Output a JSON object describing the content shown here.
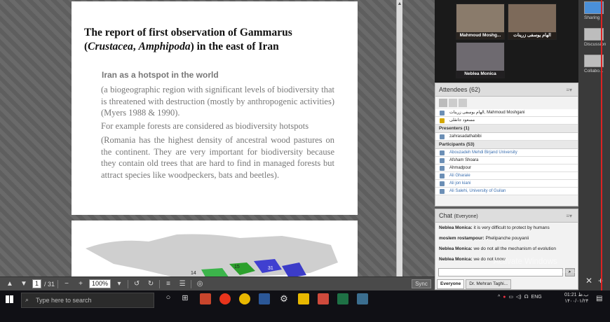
{
  "slide": {
    "title_line1": "The report of first observation of Gammarus",
    "title_line2_prefix": "(",
    "title_crustacea": "Crustacea",
    "title_comma": ", ",
    "title_amphipoda": "Amphipoda",
    "title_suffix": ") in the east of Iran",
    "subtitle": "Iran as a hotspot in the world",
    "para1": "(a biogeographic region with significant levels of biodiversity that is threatened with destruction (mostly by anthropogenic activities) (Myers 1988 & 1990).",
    "para2": "For example forests are considered as biodiversity hotspots",
    "para3": "(Romania has the highest density of ancestral wood pastures on the continent. They are very important for biodiversity because they contain old trees that are hard to find in managed forests but attract species like woodpeckers, bats and beetles).",
    "map_labels": [
      "14",
      "15",
      "31"
    ]
  },
  "doc_toolbar": {
    "page_current": "1",
    "page_total": "/ 31",
    "zoom": "100%",
    "sync_label": "Sync"
  },
  "videos": [
    {
      "name": "Mahmoud Moshg..."
    },
    {
      "name": "الهام یوسفی زرینات"
    },
    {
      "name": "Neblea Monica"
    }
  ],
  "attendees": {
    "header": "Attendees",
    "count": "(62)",
    "hosts_row": "الهام یوسفی زرینات, Mahmoud Moshgani",
    "host_extra": "مسعود جانقلی",
    "presenters_label": "Presenters (1)",
    "presenters": [
      "zahrasadathabibi"
    ],
    "participants_label": "Participants (53)",
    "participants": [
      "Abouzadeh Mehdi Birjand University",
      "Afsham Shoara",
      "Ahmadpour",
      "Ali Gharaie",
      "Ali jon kiani",
      "Ali Salehi, University of Guilan"
    ]
  },
  "chat": {
    "header": "Chat",
    "scope": "(Everyone)",
    "messages": [
      {
        "sender": "Neblea Monica:",
        "text": "it is very difficult to protect by humans"
      },
      {
        "sender": "moslem rostampour:",
        "text": "Phelipanche pouyanii"
      },
      {
        "sender": "Neblea Monica:",
        "text": "we do not all the mechanism of evolution"
      },
      {
        "sender": "Neblea Monica:",
        "text": "we do not know"
      }
    ],
    "tabs": [
      "Everyone",
      "Dr. Mehran Taghi..."
    ]
  },
  "rail": {
    "sharing": "Sharing",
    "discussion": "Discussion",
    "collaboration": "Collabo..."
  },
  "watermark": {
    "line1": "Activate Windows",
    "line2": "Go to Settings to activate Windows."
  },
  "taskbar": {
    "search_placeholder": "Type here to search",
    "lang": "ENG",
    "time": "01:21 ب.ظ",
    "date": "۱۴۰۰/۰۱/۲۴"
  }
}
